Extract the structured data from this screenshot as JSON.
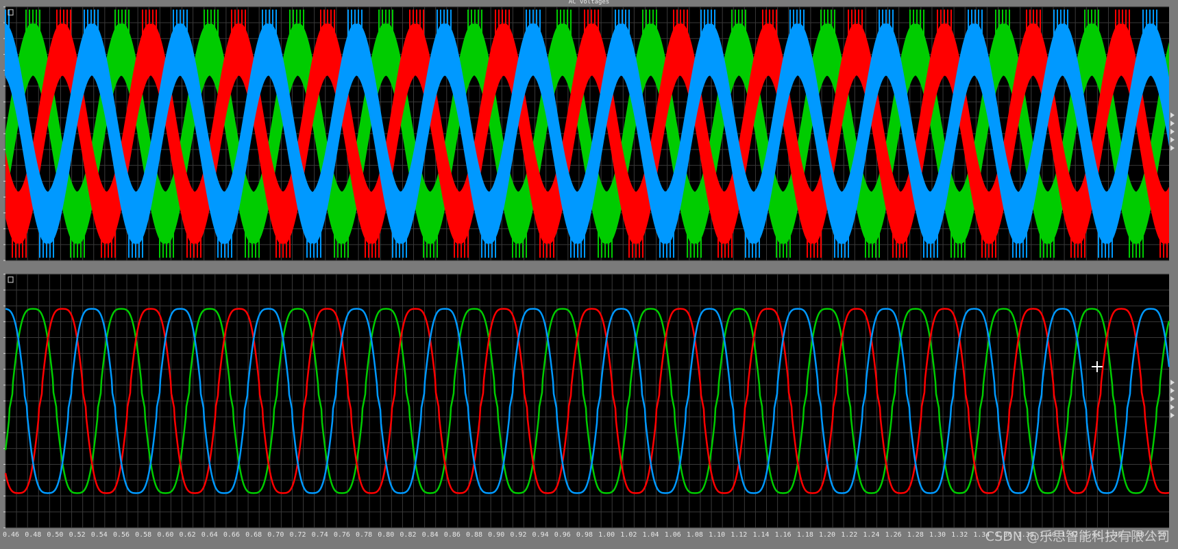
{
  "window": {
    "title": "AC voltages"
  },
  "watermark": "CSDN @乐思智能科技有限公司",
  "colors": {
    "phase_a": "#ff0000",
    "phase_b": "#00cc00",
    "phase_c": "#0099ff",
    "background": "#000000",
    "frame": "#7a7a7a",
    "grid": "#3a3a3a"
  },
  "chart_data": [
    {
      "type": "line",
      "title": "AC voltages",
      "description_of_series": "PWM phase voltages (switched, dense band)",
      "xlim": [
        0.455,
        1.51
      ],
      "ylim": [
        -1,
        1
      ],
      "grid": true,
      "series": [
        {
          "color": "#00cc00",
          "period": 0.08,
          "phase_deg": 90
        },
        {
          "color": "#ff0000",
          "period": 0.08,
          "phase_deg": -30
        },
        {
          "color": "#0099ff",
          "period": 0.08,
          "phase_deg": 210
        }
      ]
    },
    {
      "type": "line",
      "xlim": [
        0.455,
        1.51
      ],
      "ylim": [
        -1,
        1
      ],
      "grid": true,
      "x_ticks": [
        "0.46",
        "0.48",
        "0.50",
        "0.52",
        "0.54",
        "0.56",
        "0.58",
        "0.60",
        "0.62",
        "0.64",
        "0.66",
        "0.68",
        "0.70",
        "0.72",
        "0.74",
        "0.76",
        "0.78",
        "0.80",
        "0.82",
        "0.84",
        "0.86",
        "0.88",
        "0.90",
        "0.92",
        "0.94",
        "0.96",
        "0.98",
        "1.00",
        "1.02",
        "1.04",
        "1.06",
        "1.08",
        "1.10",
        "1.12",
        "1.14",
        "1.16",
        "1.18",
        "1.20",
        "1.22",
        "1.24",
        "1.26",
        "1.28",
        "1.30",
        "1.32",
        "1.34",
        "1.36",
        "1.38",
        "1.40",
        "1.42",
        "1.44",
        "1.46",
        "1.48",
        "1.50"
      ],
      "series": [
        {
          "color": "#00cc00",
          "period": 0.08,
          "phase_deg": 90
        },
        {
          "color": "#ff0000",
          "period": 0.08,
          "phase_deg": -30
        },
        {
          "color": "#0099ff",
          "period": 0.08,
          "phase_deg": 210
        }
      ]
    }
  ]
}
